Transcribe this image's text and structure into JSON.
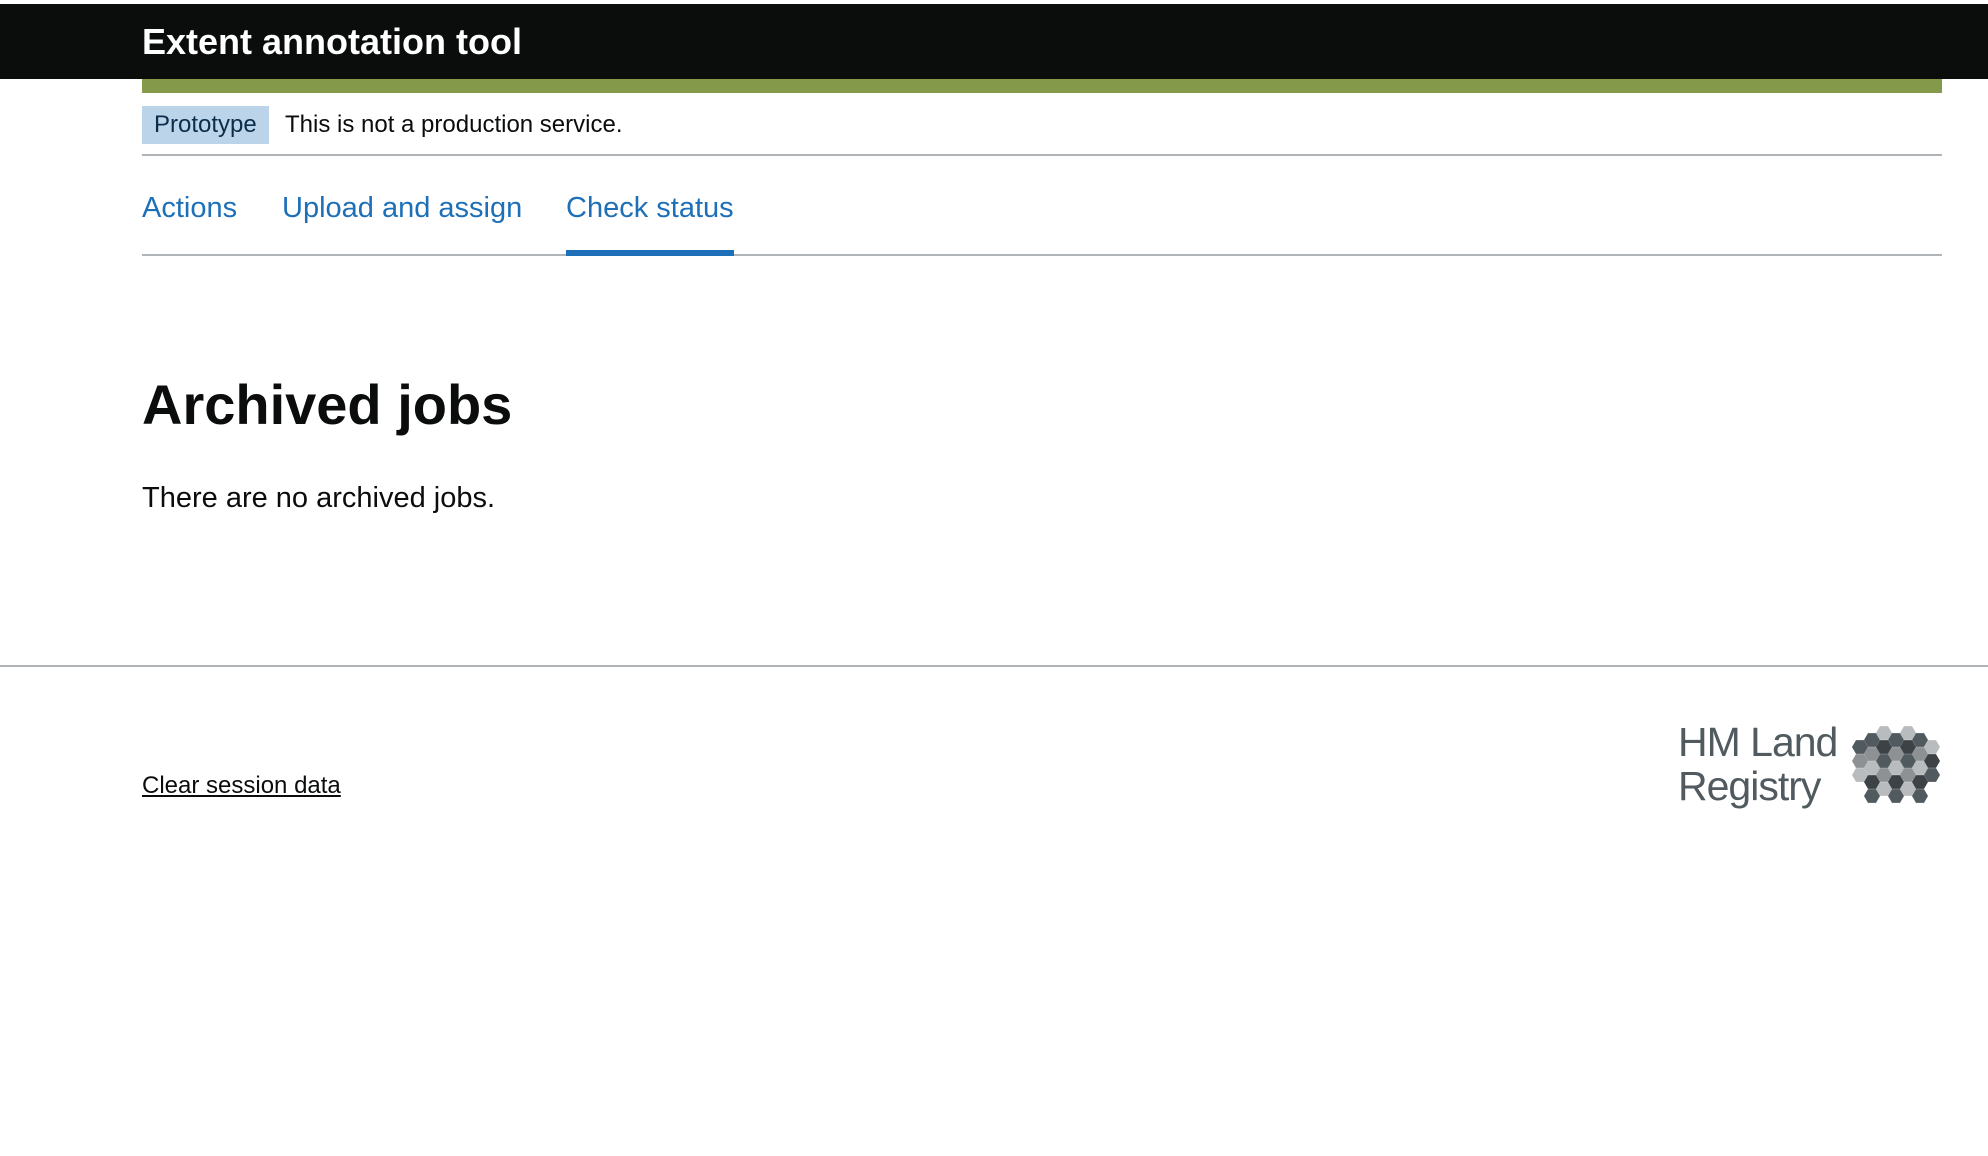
{
  "header": {
    "service_name": "Extent annotation tool"
  },
  "phase_banner": {
    "tag": "Prototype",
    "text": "This is not a production service."
  },
  "tabs": [
    {
      "label": "Actions",
      "active": false
    },
    {
      "label": "Upload and assign",
      "active": false
    },
    {
      "label": "Check status",
      "active": true
    }
  ],
  "main": {
    "title": "Archived jobs",
    "empty_message": "There are no archived jobs."
  },
  "footer": {
    "link_label": "Clear session data",
    "logo": {
      "line1": "HM Land",
      "line2": "Registry",
      "icon": "hexagon-cluster-icon"
    }
  },
  "colors": {
    "header_bg": "#0b0c0c",
    "stripe": "#85994b",
    "link": "#1d70b8",
    "phase_tag_bg": "#bbd4ea"
  }
}
